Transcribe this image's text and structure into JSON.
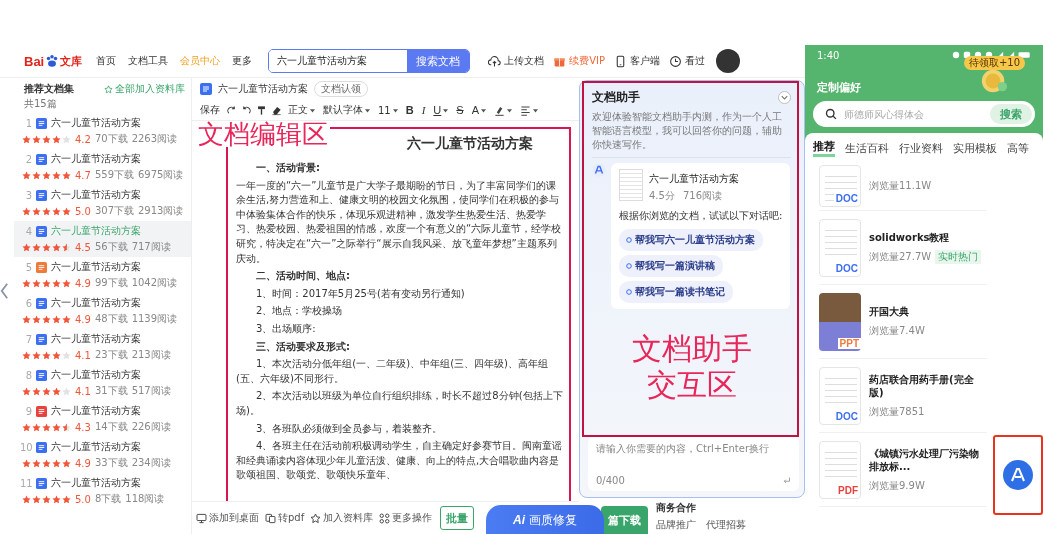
{
  "site": {
    "logo": {
      "left": "Bai",
      "right": "文库"
    },
    "nav": [
      {
        "label": "首页",
        "kind": "plain"
      },
      {
        "label": "文档工具",
        "kind": "plain"
      },
      {
        "label": "会员中心",
        "kind": "vip"
      },
      {
        "label": "更多",
        "kind": "plain"
      }
    ],
    "search": {
      "value": "六一儿童节活动方案",
      "button": "搜索文档"
    },
    "actions": [
      {
        "kind": "upload",
        "label": "上传文档"
      },
      {
        "kind": "vip",
        "label": "续费VIP"
      },
      {
        "kind": "client",
        "label": "客户端"
      },
      {
        "kind": "history",
        "label": "看过"
      }
    ]
  },
  "sidebar": {
    "title": "推荐文档集",
    "add_all": "全部加入资料库",
    "count": "共15篇",
    "items": [
      {
        "index": "1",
        "kind": "word",
        "title": "六一儿童节活动方案",
        "stars": 4,
        "rating": "4.2",
        "downloads": "70下载",
        "reads": "2263阅读",
        "selected": false
      },
      {
        "index": "2",
        "kind": "word",
        "title": "六一儿童节活动方案",
        "stars": 5,
        "rating": "4.7",
        "downloads": "559下载",
        "reads": "6975阅读",
        "selected": false
      },
      {
        "index": "3",
        "kind": "word",
        "title": "六一儿童节活动方案",
        "stars": 5,
        "rating": "5.0",
        "downloads": "307下载",
        "reads": "2913阅读",
        "selected": false
      },
      {
        "index": "4",
        "kind": "word",
        "title": "六一儿童节活动方案",
        "stars": 4.5,
        "rating": "4.5",
        "downloads": "56下载",
        "reads": "717阅读",
        "selected": true
      },
      {
        "index": "5",
        "kind": "ppt",
        "title": "六一儿童节活动方案",
        "stars": 5,
        "rating": "4.9",
        "downloads": "99下载",
        "reads": "1042阅读",
        "selected": false
      },
      {
        "index": "6",
        "kind": "word",
        "title": "六一儿童节活动方案",
        "stars": 5,
        "rating": "4.9",
        "downloads": "48下载",
        "reads": "1139阅读",
        "selected": false
      },
      {
        "index": "7",
        "kind": "word",
        "title": "六一儿童节活动方案",
        "stars": 4,
        "rating": "4.1",
        "downloads": "23下载",
        "reads": "213阅读",
        "selected": false
      },
      {
        "index": "8",
        "kind": "word",
        "title": "六一儿童节活动方案",
        "stars": 4,
        "rating": "4.1",
        "downloads": "31下载",
        "reads": "517阅读",
        "selected": false
      },
      {
        "index": "9",
        "kind": "pdf",
        "title": "六一儿童节活动方案",
        "stars": 4.5,
        "rating": "4.3",
        "downloads": "14下载",
        "reads": "226阅读",
        "selected": false
      },
      {
        "index": "10",
        "kind": "word",
        "title": "六一儿童节活动方案",
        "stars": 5,
        "rating": "4.9",
        "downloads": "33下载",
        "reads": "234阅读",
        "selected": false
      },
      {
        "index": "11",
        "kind": "word",
        "title": "六一儿童节活动方案",
        "stars": 5,
        "rating": "5.0",
        "downloads": "8下载",
        "reads": "118阅读",
        "selected": false
      }
    ]
  },
  "editor": {
    "doc_name": "六一儿童节活动方案",
    "claim_tag": "文档认领",
    "toolbar": [
      {
        "kind": "text",
        "label": "保存"
      },
      {
        "kind": "redo"
      },
      {
        "kind": "undo"
      },
      {
        "kind": "painter"
      },
      {
        "kind": "eraser"
      },
      {
        "kind": "dropdown",
        "label": "正文"
      },
      {
        "kind": "dropdown",
        "label": "默认字体"
      },
      {
        "kind": "dropdown",
        "label": "11"
      },
      {
        "kind": "bold",
        "label": "B"
      },
      {
        "kind": "italic",
        "label": "I"
      },
      {
        "kind": "underline",
        "label": "U",
        "caret": true
      },
      {
        "kind": "strike",
        "label": "S"
      },
      {
        "kind": "color",
        "label": "A",
        "caret": true
      },
      {
        "kind": "highlight",
        "caret": true
      },
      {
        "kind": "align",
        "caret": true
      }
    ],
    "annotation": "文档编辑区",
    "document": {
      "title": "六一儿童节活动方案",
      "blocks": [
        {
          "kind": "heading",
          "text": "一、活动背景:"
        },
        {
          "kind": "para",
          "text": "一年一度的“六一”儿童节是广大学子最期盼的节日，为了丰富同学们的课余生活,努力营造和上、健康文明的校园文化氛围，使同学们在积极的参与中体验集体合作的快乐，体现乐观进精神，激发学生热爱生活、热爱学习、热爱校园、热爱祖国的情感，欢度一个有意义的“六际儿童节，经学校研究，特决定在“六一”之际举行“展示自我风采、放飞童年梦想”主题系列庆动。"
        },
        {
          "kind": "heading",
          "text": "二、活动时间、地点:"
        },
        {
          "kind": "item",
          "text": "1、时间：2017年5月25号(若有变动另行通知)"
        },
        {
          "kind": "item",
          "text": "2、地点：学校操场"
        },
        {
          "kind": "item",
          "text": "3、出场顺序:"
        },
        {
          "kind": "heading",
          "text": "三、活动要求及形式:"
        },
        {
          "kind": "item",
          "text": "1、本次活动分低年组(一、二年级)、中年组(三、四年级)、高年组(五、六年级)不同形行。"
        },
        {
          "kind": "item",
          "text": "2、本次活动以班级为单位自行组织排练，时长不超过8分钟(包括上下场)。"
        },
        {
          "kind": "item",
          "text": "3、各班队必须做到全员参与，着装整齐。"
        },
        {
          "kind": "item",
          "text": "4、各班主任在活动前积极调动学生，自主确定好参赛节目。闽南童谣和经典诵读内容体现少年儿童活泼、健康、向上的特点,大合唱歌曲内容是歌颂祖国、歌颂党、歌颂快乐童年、"
        }
      ]
    },
    "bottom_actions": [
      {
        "kind": "desktop",
        "label": "添加到桌面"
      },
      {
        "kind": "pdf",
        "label": "转pdf"
      },
      {
        "kind": "star",
        "label": "加入资料库"
      },
      {
        "kind": "more",
        "label": "更多操作"
      }
    ],
    "batch_button": "批量"
  },
  "assistant": {
    "title": "文档助手",
    "description": "欢迎体验智能文档助手内测，作为一个人工智能语言模型，我可以回答你的问题，辅助你快速写作。",
    "doc": {
      "title": "六一儿童节活动方案",
      "score": "4.5分",
      "reads": "716阅读"
    },
    "prompt": "根据你浏览的文档，试试以下对话吧:",
    "suggestions": [
      "帮我写六一儿童节活动方案",
      "帮我写一篇演讲稿",
      "帮我写一篇读书笔记"
    ],
    "annotation": [
      "文档助手",
      "交互区"
    ],
    "input": {
      "placeholder": "请输入你需要的内容，Ctrl+Enter换行",
      "counter": "0/400"
    }
  },
  "download_button": "篇下载",
  "business": {
    "title": "商务合作",
    "links": [
      "品牌推广",
      "代理招募"
    ]
  },
  "ai_pill": {
    "badge": "Ai",
    "label": "画质修复"
  },
  "phone": {
    "time": "1:40",
    "header": "定制偏好",
    "reward": "待领取+10",
    "search": {
      "placeholder": "师德师风心得体会",
      "button": "搜索"
    },
    "tabs": [
      {
        "label": "推荐",
        "selected": true
      },
      {
        "label": "生活百科",
        "selected": false
      },
      {
        "label": "行业资料",
        "selected": false
      },
      {
        "label": "实用模板",
        "selected": false
      },
      {
        "label": "高等",
        "selected": false
      }
    ],
    "items": [
      {
        "views": "浏览量11.1W",
        "photo": false,
        "kind": "word",
        "type_label": "DOC"
      },
      {
        "title": "solidworks教程",
        "views": "浏览量27.7W",
        "tag": "实时热门",
        "photo": false,
        "kind": "word",
        "type_label": "DOC"
      },
      {
        "title": "开国大典",
        "views": "浏览量7.4W",
        "photo": true,
        "kind": "ppt",
        "type_label": "PPT"
      },
      {
        "title": "药店联合用药手册(完全版)",
        "views": "浏览量7851",
        "photo": false,
        "kind": "word",
        "type_label": "DOC"
      },
      {
        "title": "《城镇污水处理厂污染物排放标...",
        "views": "浏览量9.9W",
        "photo": false,
        "kind": "pdf",
        "type_label": "PDF"
      }
    ],
    "fab": {
      "annotated": true
    }
  }
}
